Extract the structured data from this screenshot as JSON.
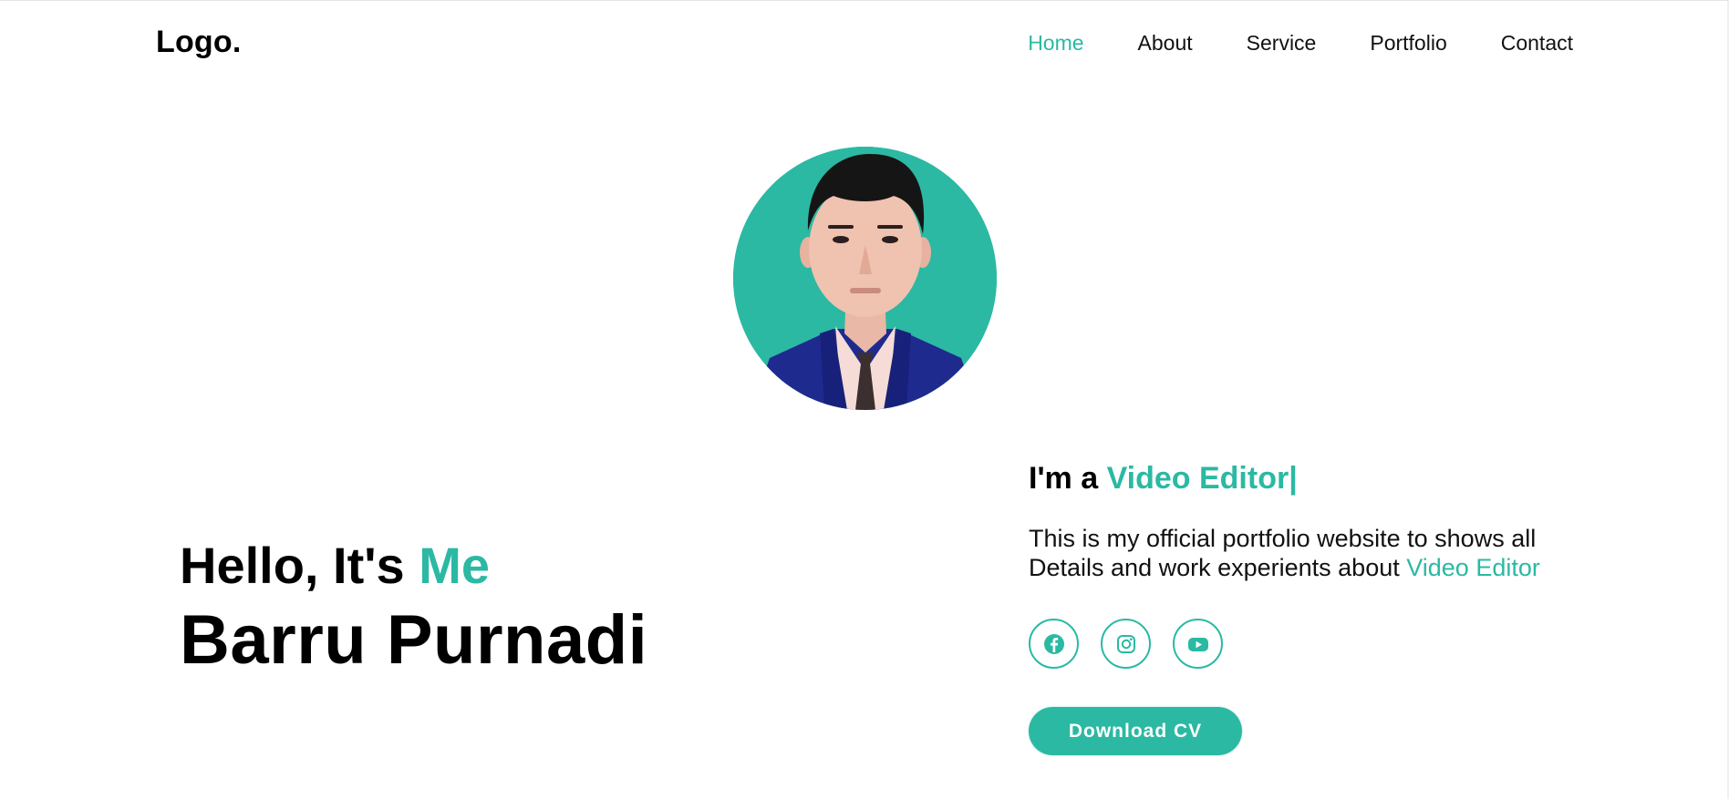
{
  "header": {
    "logo": "Logo.",
    "nav": [
      {
        "label": "Home",
        "active": true
      },
      {
        "label": "About",
        "active": false
      },
      {
        "label": "Service",
        "active": false
      },
      {
        "label": "Portfolio",
        "active": false
      },
      {
        "label": "Contact",
        "active": false
      }
    ]
  },
  "hero": {
    "greeting_prefix": "Hello, It's",
    "greeting_accent": "Me",
    "name": "Barru Purnadi",
    "role_prefix": "I'm a",
    "role_accent": "Video Editor",
    "role_cursor": "|",
    "description_prefix": "This is my official portfolio website to shows all Details and work experients about",
    "description_accent": "Video Editor",
    "socials": [
      {
        "icon": "facebook-icon"
      },
      {
        "icon": "instagram-icon"
      },
      {
        "icon": "youtube-icon"
      }
    ],
    "cta_label": "Download CV"
  },
  "colors": {
    "accent": "#2bb9a3",
    "text": "#000000",
    "background": "#ffffff"
  }
}
